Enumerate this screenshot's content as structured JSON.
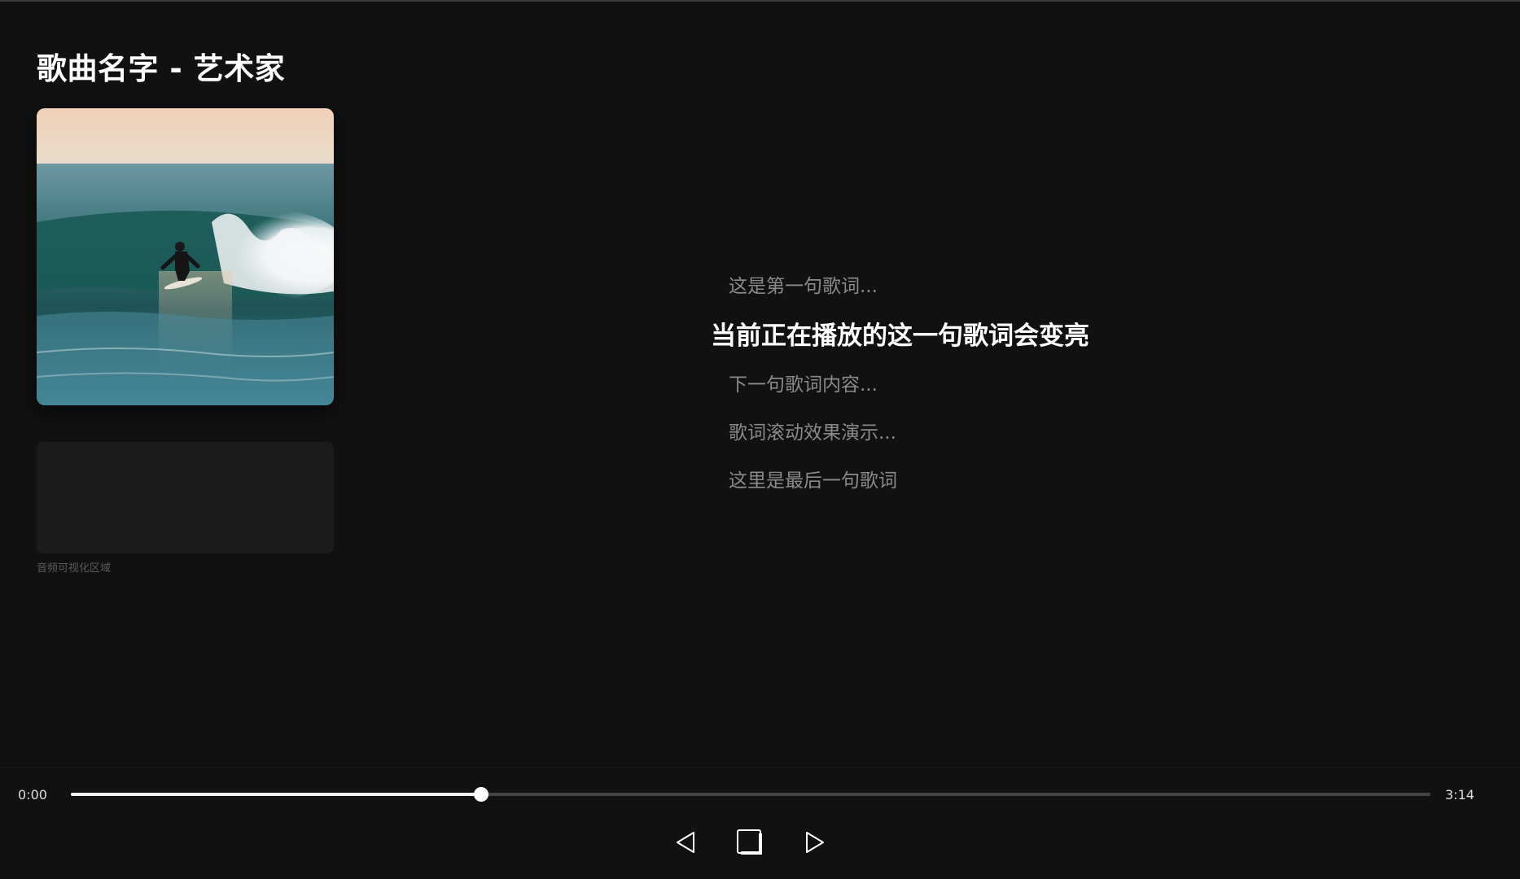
{
  "header": {
    "title": "歌曲名字 - 艺术家"
  },
  "cover": {
    "icon": "album-cover-image"
  },
  "visualizer": {
    "label": "音频可视化区域"
  },
  "lyrics": {
    "lines": [
      {
        "text": "这是第一句歌词...",
        "active": false
      },
      {
        "text": "当前正在播放的这一句歌词会变亮",
        "active": true
      },
      {
        "text": "下一句歌词内容...",
        "active": false
      },
      {
        "text": "歌词滚动效果演示...",
        "active": false
      },
      {
        "text": "这里是最后一句歌词",
        "active": false
      }
    ]
  },
  "player": {
    "current_time": "0:00",
    "total_time": "3:14",
    "progress": 0.302,
    "controls": {
      "prev_icon": "previous-icon",
      "stop_icon": "stop-icon",
      "next_icon": "next-icon"
    }
  },
  "colors": {
    "background": "#111111",
    "accent": "#ffffff",
    "muted_text": "#8a8a8a",
    "track": "#444444"
  }
}
